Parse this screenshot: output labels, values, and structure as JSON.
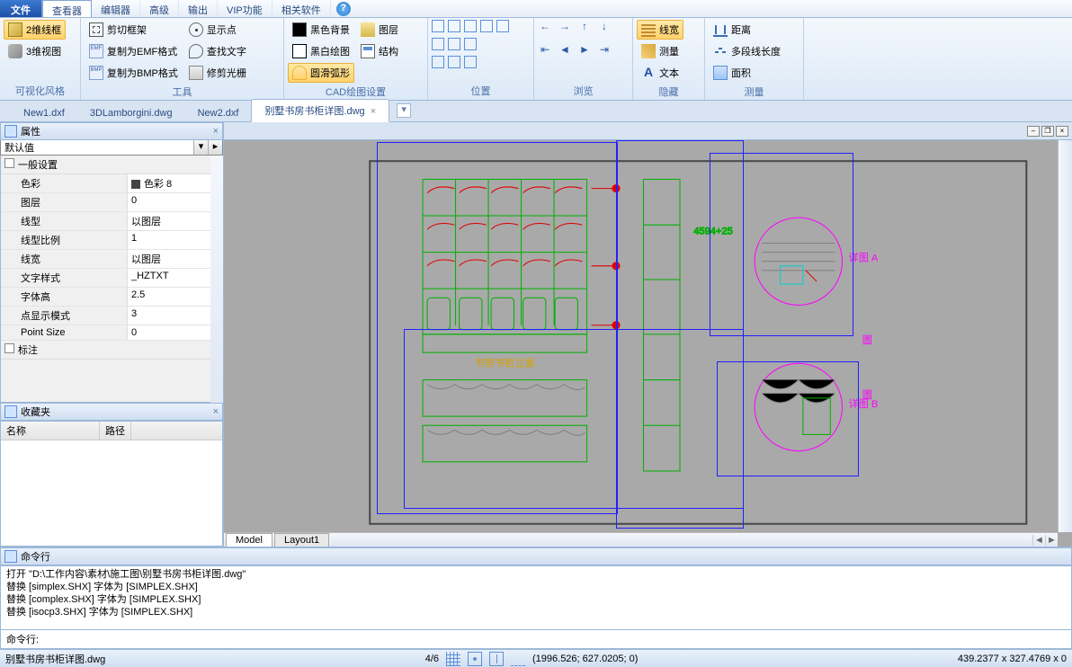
{
  "menu": {
    "file": "文件",
    "items": [
      "查看器",
      "编辑器",
      "高级",
      "输出",
      "VIP功能",
      "相关软件"
    ],
    "active_index": 0
  },
  "ribbon": {
    "groups": [
      {
        "label": "可视化风格",
        "buttons": {
          "b2d": "2维线框",
          "b3d": "3维视图"
        }
      },
      {
        "label": "工具",
        "buttons": {
          "crop": "剪切框架",
          "emf": "复制为EMF格式",
          "bmp": "复制为BMP格式",
          "dot": "显示点",
          "find": "查找文字",
          "trim": "修剪光栅"
        }
      },
      {
        "label": "CAD绘图设置",
        "buttons": {
          "bgblack": "黑色背景",
          "bgbw": "黑白绘图",
          "arc": "圆滑弧形",
          "layer": "图层",
          "struct": "结构"
        }
      },
      {
        "label": "位置"
      },
      {
        "label": "浏览"
      },
      {
        "label": "隐藏",
        "buttons": {
          "lw": "线宽",
          "meas": "测量",
          "text": "文本"
        }
      },
      {
        "label": "测量",
        "buttons": {
          "dist": "距离",
          "poly": "多段线长度",
          "area": "面积"
        }
      }
    ]
  },
  "tabs": {
    "items": [
      "New1.dxf",
      "3DLamborgini.dwg",
      "New2.dxf",
      "别墅书房书柜详图.dwg"
    ],
    "active_index": 3
  },
  "panels": {
    "properties_title": "属性",
    "favorites_title": "收藏夹",
    "command_title": "命令行"
  },
  "properties": {
    "selector": "默认值",
    "cat_general": "一般设置",
    "cat_annot": "标注",
    "rows": [
      {
        "k": "色彩",
        "v": "色彩 8",
        "swatch": true
      },
      {
        "k": "图层",
        "v": "0"
      },
      {
        "k": "线型",
        "v": "以图层"
      },
      {
        "k": "线型比例",
        "v": "1"
      },
      {
        "k": "线宽",
        "v": "以图层"
      },
      {
        "k": "文字样式",
        "v": "_HZTXT"
      },
      {
        "k": "字体高",
        "v": "2.5"
      },
      {
        "k": "点显示模式",
        "v": "3"
      },
      {
        "k": "Point Size",
        "v": "0"
      }
    ]
  },
  "favorites": {
    "col_name": "名称",
    "col_path": "路径"
  },
  "layout_tabs": {
    "model": "Model",
    "layout1": "Layout1"
  },
  "command": {
    "log": "打开 \"D:\\工作内容\\素材\\施工图\\别墅书房书柜详图.dwg\"\n替换 [simplex.SHX] 字体为 [SIMPLEX.SHX]\n替换 [complex.SHX] 字体为 [SIMPLEX.SHX]\n替换 [isocp3.SHX] 字体为 [SIMPLEX.SHX]",
    "prompt": "命令行:",
    "input": ""
  },
  "status": {
    "file": "别墅书房书柜详图.dwg",
    "page": "4/6",
    "coords": "(1996.526; 627.0205; 0)",
    "extents": "439.2377 x 327.4769 x 0"
  }
}
